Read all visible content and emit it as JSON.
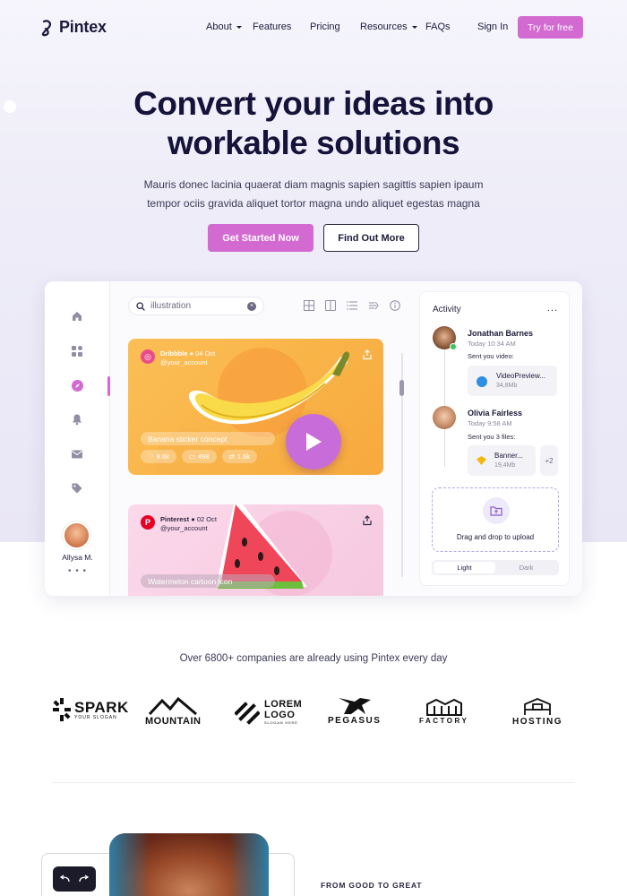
{
  "nav": {
    "brand": "Pintex",
    "links": [
      {
        "label": "About",
        "has_caret": true
      },
      {
        "label": "Features",
        "has_caret": false
      },
      {
        "label": "Pricing",
        "has_caret": false
      },
      {
        "label": "Resources",
        "has_caret": true
      },
      {
        "label": "FAQs",
        "has_caret": false
      }
    ],
    "signin": "Sign In",
    "cta": "Try for free"
  },
  "hero": {
    "title_line1": "Convert your ideas into",
    "title_line2": "workable solutions",
    "subtitle_line1": "Mauris donec lacinia quaerat diam magnis sapien sagittis sapien ipaum",
    "subtitle_line2": "tempor ociis gravida aliquet tortor magna undo aliquet egestas magna",
    "primary_btn": "Get Started Now",
    "secondary_btn": "Find Out More"
  },
  "app": {
    "sidebar": {
      "icons": [
        "home-icon",
        "widgets-icon",
        "compass-icon",
        "bell-icon",
        "mail-icon",
        "tag-icon"
      ],
      "active_index": 2,
      "user_name": "Allysa M.",
      "more": "• • •"
    },
    "search": {
      "value": "illustration"
    },
    "cards": [
      {
        "source": "Dribbble",
        "date": "04 Oct",
        "handle": "@your_account",
        "caption": "Banana sticker concept",
        "likes": "8.6k",
        "comments": "498",
        "shares": "1.6k"
      },
      {
        "source": "Pinterest",
        "date": "02 Oct",
        "handle": "@your_account",
        "caption": "Watermelon cartoon icon"
      }
    ],
    "activity": {
      "title": "Activity",
      "more": "...",
      "items": [
        {
          "name": "Jonathan Barnes",
          "time": "Today 10:34 AM",
          "desc": "Sent you video:",
          "file_name": "VideoPreview...",
          "file_size": "34,8Mb"
        },
        {
          "name": "Olivia Fairless",
          "time": "Today 9:58 AM",
          "desc": "Sent you 3 files:",
          "file_name": "Banner...",
          "file_size": "19,4Mb",
          "extra": "+2"
        }
      ],
      "upload_text": "Drag and drop to upload",
      "theme": {
        "light": "Light",
        "dark": "Dark",
        "selected": "Light"
      }
    }
  },
  "companies": {
    "text": "Over 6800+ companies are already using Pintex every day",
    "logos": [
      {
        "name": "SPARK",
        "tagline": "YOUR SLOGAN"
      },
      {
        "name": "MOUNTAIN"
      },
      {
        "name": "LOREM LOGO",
        "tagline": "SLOGAN HERE"
      },
      {
        "name": "PEGASUS"
      },
      {
        "name": "FACTORY"
      },
      {
        "name": "HOSTING"
      }
    ]
  },
  "feature": {
    "eyebrow": "FROM GOOD TO GREAT"
  },
  "colors": {
    "accent": "#d36ad1",
    "dark": "#15133a",
    "play": "#c86cd9"
  }
}
